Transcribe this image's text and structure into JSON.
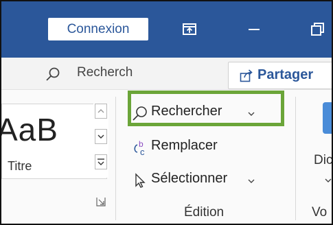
{
  "titlebar": {
    "signin_label": "Connexion",
    "icons": [
      "ribbon-display-options-icon",
      "minimize-icon",
      "restore-icon"
    ]
  },
  "search": {
    "icon": "search-icon",
    "placeholder": "Recherch"
  },
  "share": {
    "icon": "share-icon",
    "label": "Partager"
  },
  "styles": {
    "preview_text": "AaB",
    "style_name": "Titre"
  },
  "edit_group": {
    "find_label": "Rechercher",
    "replace_label": "Remplacer",
    "select_label": "Sélectionner",
    "group_label": "Édition"
  },
  "dictate": {
    "label": "Dic",
    "group_label": "Vo"
  },
  "colors": {
    "titlebar": "#2b579a",
    "highlight": "#6ba539",
    "accent": "#2b579a"
  }
}
